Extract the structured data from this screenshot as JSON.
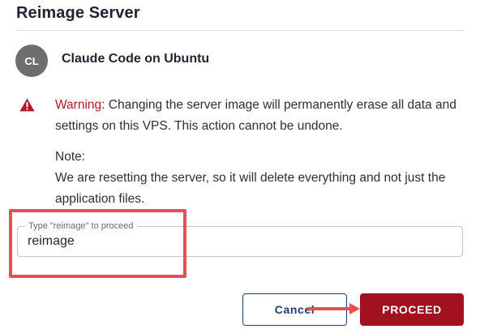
{
  "dialog": {
    "title": "Reimage Server"
  },
  "server": {
    "avatar_initials": "CL",
    "name": "Claude Code on Ubuntu"
  },
  "warning": {
    "icon": "warning-triangle-icon",
    "label": "Warning:",
    "text": " Changing the server image will permanently erase all data and settings on this VPS. This action cannot be undone."
  },
  "note": {
    "heading": "Note:",
    "text": "We are resetting the server, so it will delete everything and not just the application files."
  },
  "confirm_field": {
    "label": "Type \"reimage\" to proceed",
    "value": "reimage"
  },
  "actions": {
    "cancel_label": "Cancel",
    "proceed_label": "PROCEED"
  },
  "colors": {
    "accent_red": "#a1121e",
    "warning_red": "#b5162a",
    "navy": "#1f3e77",
    "annotation": "#e8504f"
  }
}
